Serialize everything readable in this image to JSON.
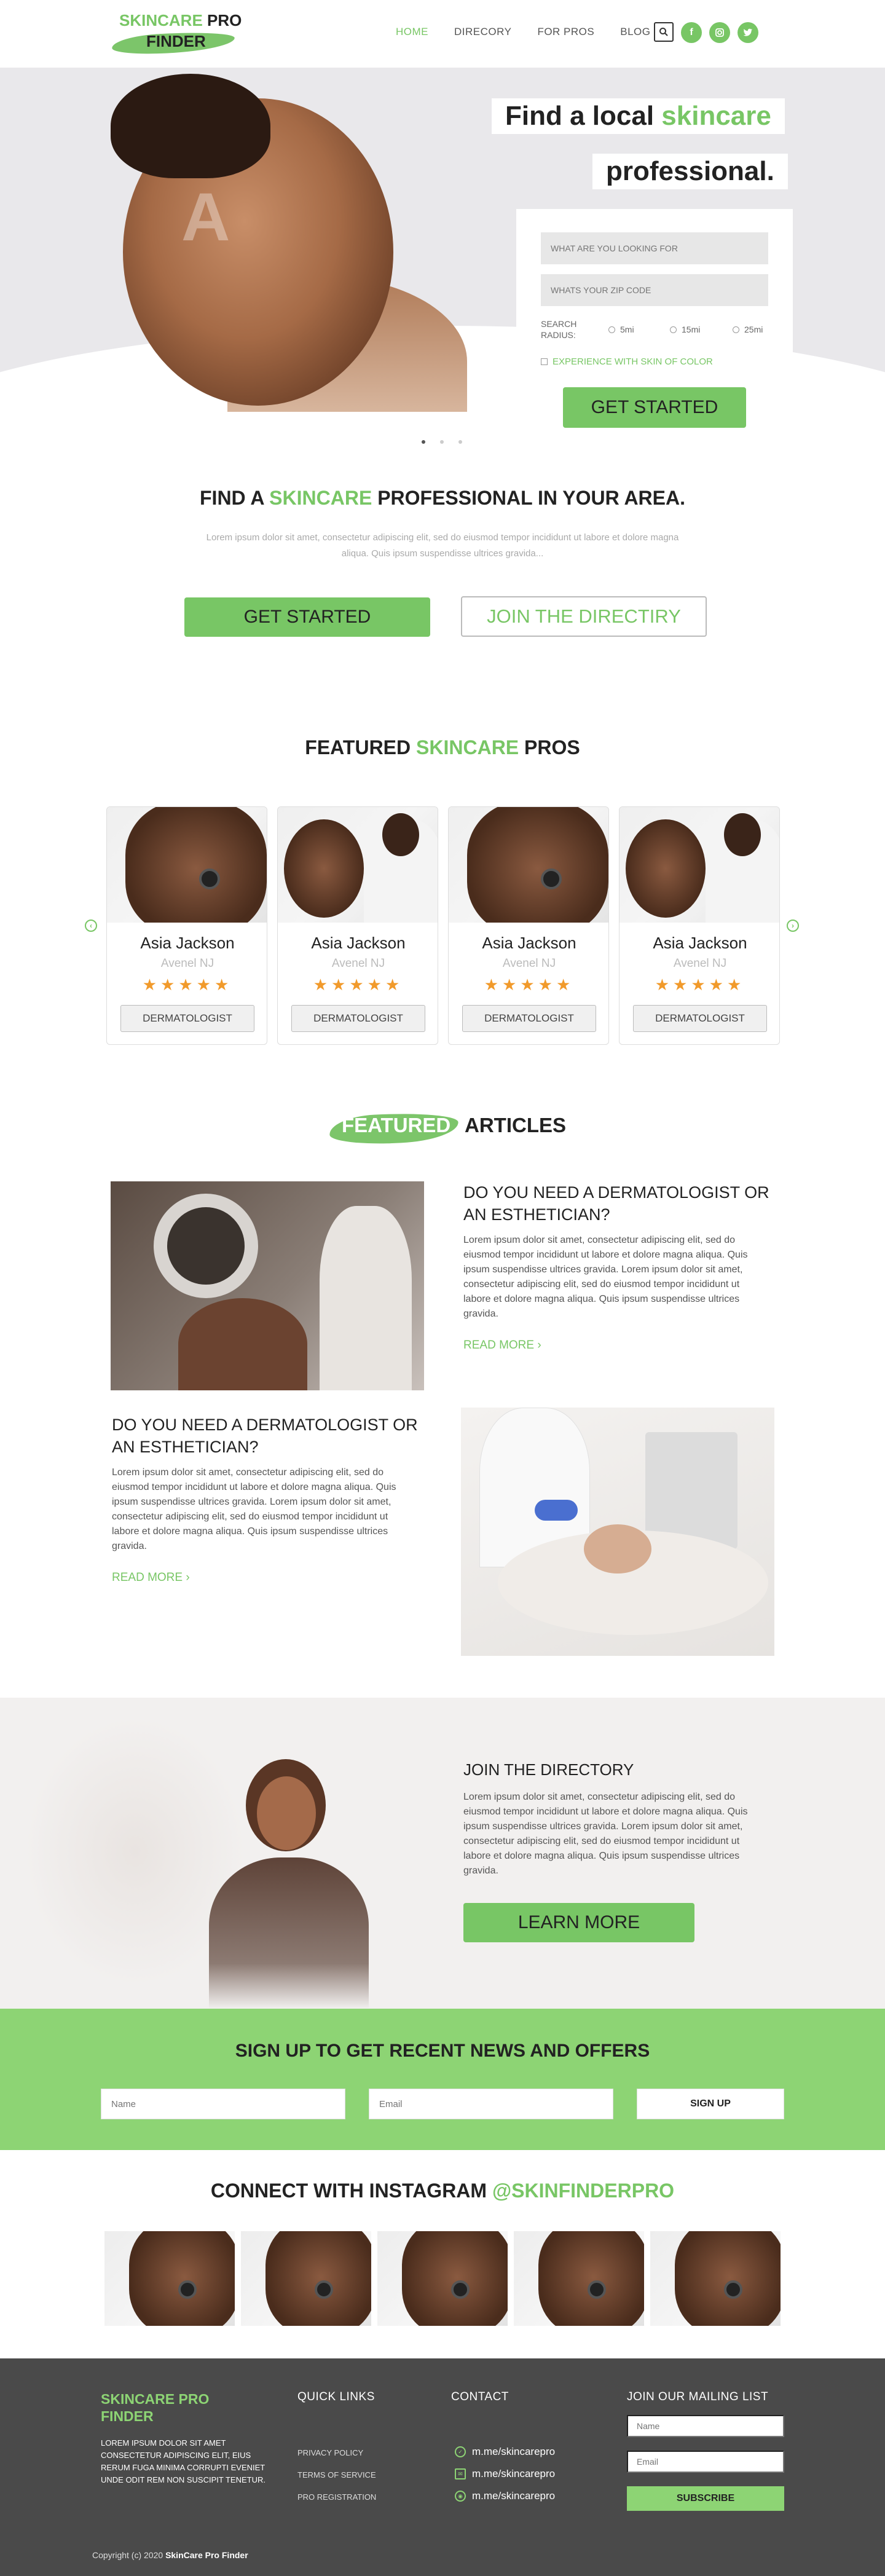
{
  "nav": {
    "logo_green": "SKINCARE",
    "logo_dark": "PRO",
    "logo_line2": "FINDER",
    "menu": [
      "HOME",
      "DIRECORY",
      "FOR PROS",
      "BLOG"
    ],
    "icons": [
      "search-icon",
      "facebook-icon",
      "instagram-icon",
      "twitter-icon"
    ]
  },
  "hero": {
    "line1_dark": "Find a local",
    "line1_green": "skincare",
    "line2": "professional.",
    "search_placeholder": "WHAT ARE YOU LOOKING FOR",
    "zip_placeholder": "WHATS YOUR ZIP CODE",
    "radius_label": "SEARCH RADIUS:",
    "radius_options": [
      "5mi",
      "15mi",
      "25mi"
    ],
    "checkbox_label": "EXPERIENCE WITH SKIN OF COLOR",
    "cta": "GET STARTED"
  },
  "find": {
    "title_dark1": "FIND A",
    "title_green": "SKINCARE",
    "title_dark2": "PROFESSIONAL IN YOUR AREA.",
    "text": "Lorem ipsum dolor sit amet, consectetur adipiscing elit, sed do eiusmod tempor incididunt ut labore et dolore magna aliqua. Quis ipsum suspendisse ultrices gravida...",
    "btn_primary": "GET STARTED",
    "btn_secondary": "JOIN THE DIRECTIRY"
  },
  "pros": {
    "title_dark1": "FEATURED",
    "title_green": "SKINCARE",
    "title_dark2": "PROS",
    "cards": [
      {
        "name": "Asia Jackson",
        "location": "Avenel NJ",
        "tag": "DERMATOLOGIST",
        "stars": "★★★★★"
      },
      {
        "name": "Asia Jackson",
        "location": "Avenel NJ",
        "tag": "DERMATOLOGIST",
        "stars": "★★★★★"
      },
      {
        "name": "Asia Jackson",
        "location": "Avenel NJ",
        "tag": "DERMATOLOGIST",
        "stars": "★★★★★"
      },
      {
        "name": "Asia Jackson",
        "location": "Avenel NJ",
        "tag": "DERMATOLOGIST",
        "stars": "★★★★★"
      }
    ]
  },
  "articles": {
    "title_brush": "FEATURED",
    "title_dark": "ARTICLES",
    "items": [
      {
        "heading": "DO YOU NEED A DERMATOLOGIST OR AN ESTHETICIAN?",
        "text": "Lorem ipsum dolor sit amet, consectetur adipiscing elit, sed do eiusmod tempor incididunt ut labore et dolore magna aliqua. Quis ipsum suspendisse ultrices gravida. Lorem ipsum dolor sit amet, consectetur adipiscing elit, sed do eiusmod tempor incididunt ut labore et dolore magna aliqua. Quis ipsum suspendisse ultrices gravida.",
        "link": "READ MORE"
      },
      {
        "heading": "DO YOU NEED A DERMATOLOGIST OR AN ESTHETICIAN?",
        "text": "Lorem ipsum dolor sit amet, consectetur adipiscing elit, sed do eiusmod tempor incididunt ut labore et dolore magna aliqua. Quis ipsum suspendisse ultrices gravida. Lorem ipsum dolor sit amet, consectetur adipiscing elit, sed do eiusmod tempor incididunt ut labore et dolore magna aliqua. Quis ipsum suspendisse ultrices gravida.",
        "link": "READ MORE"
      }
    ]
  },
  "join": {
    "heading": "JOIN THE DIRECTORY",
    "text": "Lorem ipsum dolor sit amet, consectetur adipiscing elit, sed do eiusmod tempor incididunt ut labore et dolore magna aliqua. Quis ipsum suspendisse ultrices gravida. Lorem ipsum dolor sit amet, consectetur adipiscing elit, sed do eiusmod tempor incididunt ut labore et dolore magna aliqua. Quis ipsum suspendisse ultrices gravida.",
    "cta": "LEARN MORE"
  },
  "newsletter": {
    "title": "SIGN UP TO GET RECENT NEWS AND OFFERS",
    "name_placeholder": "Name",
    "email_placeholder": "Email",
    "button": "SIGN UP"
  },
  "instagram": {
    "title_dark": "CONNECT WITH INSTAGRAM",
    "handle": "@SKINFINDERPRO"
  },
  "footer": {
    "brand": "SKINCARE PRO FINDER",
    "about": "LOREM IPSUM DOLOR SIT AMET CONSECTETUR ADIPISCING ELIT, EIUS RERUM FUGA MINIMA CORRUPTI EVENIET UNDE ODIT REM NON SUSCIPIT TENETUR.",
    "quick_links_title": "QUICK LINKS",
    "quick_links": [
      "PRIVACY POLICY",
      "TERMS OF SERVICE",
      "PRO REGISTRATION"
    ],
    "contact_title": "CONTACT",
    "contacts": [
      "m.me/skincarepro",
      "m.me/skincarepro",
      "m.me/skincarepro"
    ],
    "mailing_title": "JOIN OUR MAILING LIST",
    "name_placeholder": "Name",
    "email_placeholder": "Email",
    "button": "SUBSCRIBE",
    "copyright_prefix": "Copyright (c) 2020",
    "copyright_brand": "SkinCare Pro Finder"
  },
  "colors": {
    "accent": "#78c665",
    "newsletter_bg": "#8dd474",
    "footer_bg": "#4a4a4a",
    "stars": "#f19a2b"
  }
}
